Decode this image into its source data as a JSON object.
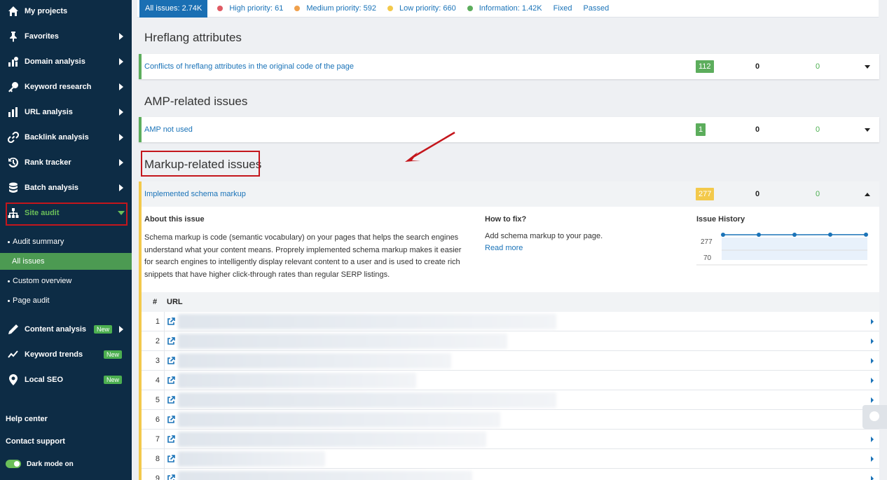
{
  "sidebar": {
    "items": [
      {
        "label": "My projects",
        "icon": "home-icon"
      },
      {
        "label": "Favorites",
        "icon": "pin-icon"
      },
      {
        "label": "Domain analysis",
        "icon": "domain-analysis-icon"
      },
      {
        "label": "Keyword research",
        "icon": "key-icon"
      },
      {
        "label": "URL analysis",
        "icon": "bar-chart-icon"
      },
      {
        "label": "Backlink analysis",
        "icon": "link-icon"
      },
      {
        "label": "Rank tracker",
        "icon": "history-icon"
      },
      {
        "label": "Batch analysis",
        "icon": "database-icon"
      },
      {
        "label": "Site audit",
        "icon": "sitemap-icon"
      }
    ],
    "site_audit_sub": [
      "Audit summary",
      "All issues",
      "Custom overview",
      "Page audit"
    ],
    "lower_items": [
      {
        "label": "Content analysis",
        "icon": "pen-icon",
        "badge": "New"
      },
      {
        "label": "Keyword trends",
        "icon": "trend-icon",
        "badge": "New"
      },
      {
        "label": "Local SEO",
        "icon": "map-pin-icon",
        "badge": "New"
      }
    ],
    "help_center": "Help center",
    "contact_support": "Contact support",
    "dark_mode": "Dark mode on"
  },
  "filters": {
    "all": "All issues: 2.74K",
    "high": "High priority: 61",
    "medium": "Medium priority: 592",
    "low": "Low priority: 660",
    "info": "Information: 1.42K",
    "fixed": "Fixed",
    "passed": "Passed"
  },
  "colors": {
    "high": "#e05a63",
    "medium": "#f0a04b",
    "low": "#f3c94b",
    "info": "#5cad5c",
    "accent": "#1a73b8",
    "sidebar_bg": "#0d2c45"
  },
  "sections": {
    "hreflang": {
      "title": "Hreflang attributes",
      "issue": "Conflicts of hreflang attributes in the original code of the page",
      "count": "112",
      "val_a": "0",
      "val_b": "0"
    },
    "amp": {
      "title": "AMP-related issues",
      "issue": "AMP not used",
      "count": "1",
      "val_a": "0",
      "val_b": "0"
    },
    "markup": {
      "title": "Markup-related issues",
      "issue": "Implemented schema markup",
      "count": "277",
      "val_a": "0",
      "val_b": "0",
      "about_title": "About this issue",
      "about_text": "Schema markup is code (semantic vocabulary) on your pages that helps the search engines understand what your content means. Proprely implemented schema markup makes it easier for search engines to intelligently display relevant content to a user and is used to create rich snippets that have higher click-through rates than regular SERP listings.",
      "howfix_title": "How to fix?",
      "howfix_text": "Add schema markup to your page.",
      "read_more": "Read more",
      "history_title": "Issue History",
      "history_ticks": [
        "277",
        "70"
      ],
      "history_values": [
        277,
        277,
        277,
        278,
        278
      ]
    }
  },
  "table": {
    "col_num": "#",
    "col_url": "URL",
    "rows": [
      "1",
      "2",
      "3",
      "4",
      "5",
      "6",
      "7",
      "8",
      "9"
    ]
  }
}
